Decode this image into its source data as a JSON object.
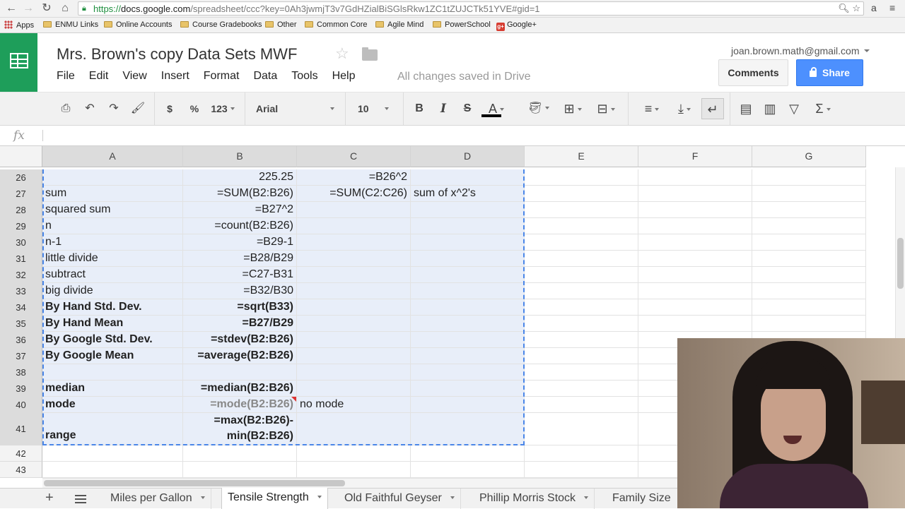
{
  "browser": {
    "url_https": "https://",
    "url_host": "docs.google.com",
    "url_rest": "/spreadsheet/ccc?key=0Ah3jwmjT3v7GdHZialBiSGlsRkw1ZC1tZUJCTk51YVE#gid=1",
    "bookmarks": [
      "Apps",
      "ENMU Links",
      "Online Accounts",
      "Course Gradebooks",
      "Other",
      "Common Core",
      "Agile Mind",
      "PowerSchool",
      "Google+"
    ]
  },
  "doc": {
    "title": "Mrs. Brown's copy Data Sets MWF",
    "account": "joan.brown.math@gmail.com",
    "comments_label": "Comments",
    "share_label": "Share",
    "saved_status": "All changes saved in Drive"
  },
  "menu": [
    "File",
    "Edit",
    "View",
    "Insert",
    "Format",
    "Data",
    "Tools",
    "Help"
  ],
  "toolbar": {
    "currency": "$",
    "percent": "%",
    "number_format": "123",
    "font": "Arial",
    "font_size": "10",
    "bold": "B",
    "italic": "I",
    "strike": "S",
    "text_color": "A"
  },
  "formula_bar": {
    "fx": "fx",
    "value": ""
  },
  "columns": [
    "A",
    "B",
    "C",
    "D",
    "E",
    "F",
    "G"
  ],
  "rows": [
    {
      "n": "26",
      "A": "",
      "B": "225.25",
      "C": "=B26^2",
      "D": ""
    },
    {
      "n": "27",
      "A": "sum",
      "B": "=SUM(B2:B26)",
      "C": "=SUM(C2:C26)",
      "D": "sum of x^2's"
    },
    {
      "n": "28",
      "A": "squared sum",
      "B": "=B27^2",
      "C": "",
      "D": ""
    },
    {
      "n": "29",
      "A": "n",
      "B": "=count(B2:B26)",
      "C": "",
      "D": ""
    },
    {
      "n": "30",
      "A": "n-1",
      "B": "=B29-1",
      "C": "",
      "D": ""
    },
    {
      "n": "31",
      "A": "little divide",
      "B": "=B28/B29",
      "C": "",
      "D": ""
    },
    {
      "n": "32",
      "A": "subtract",
      "B": "=C27-B31",
      "C": "",
      "D": ""
    },
    {
      "n": "33",
      "A": "big divide",
      "B": "=B32/B30",
      "C": "",
      "D": ""
    },
    {
      "n": "34",
      "A": "By Hand Std. Dev.",
      "B": "=sqrt(B33)",
      "C": "",
      "D": ""
    },
    {
      "n": "35",
      "A": "By Hand Mean",
      "B": "=B27/B29",
      "C": "",
      "D": ""
    },
    {
      "n": "36",
      "A": "By Google Std. Dev.",
      "B": "=stdev(B2:B26)",
      "C": "",
      "D": ""
    },
    {
      "n": "37",
      "A": "By Google Mean",
      "B": "=average(B2:B26)",
      "C": "",
      "D": ""
    },
    {
      "n": "38",
      "A": "",
      "B": "",
      "C": "",
      "D": ""
    },
    {
      "n": "39",
      "A": "median",
      "B": "=median(B2:B26)",
      "C": "",
      "D": ""
    },
    {
      "n": "40",
      "A": "mode",
      "B": "=mode(B2:B26)",
      "C": "no mode",
      "D": ""
    },
    {
      "n": "41",
      "A": "range",
      "B1": "=max(B2:B26)-",
      "B2": "min(B2:B26)",
      "C": "",
      "D": ""
    },
    {
      "n": "42"
    },
    {
      "n": "43"
    }
  ],
  "sheet_tabs": [
    "Miles per Gallon",
    "Tensile Strength",
    "Old Faithful Geyser",
    "Phillip Morris Stock",
    "Family Size"
  ],
  "active_tab": "Tensile Strength",
  "colors": {
    "brand_green": "#1e9e5a",
    "share_blue": "#4d90fe",
    "selection_fill": "#e8eef9",
    "selection_border": "#4a86e8"
  }
}
